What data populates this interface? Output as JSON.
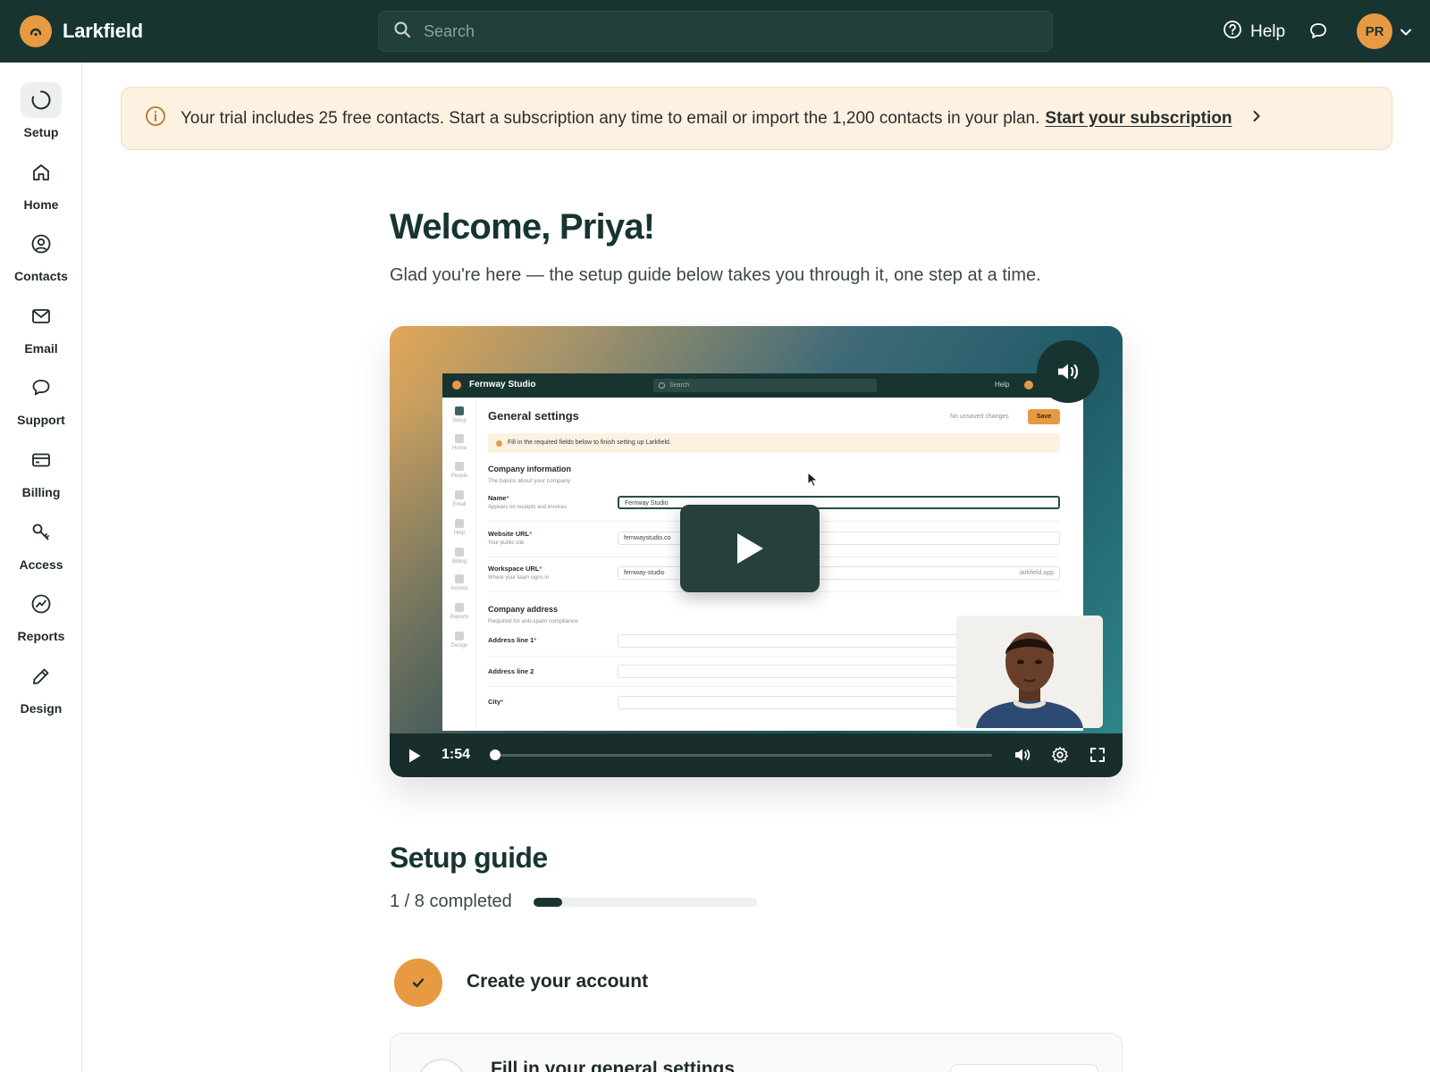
{
  "brand": {
    "name": "Larkfield"
  },
  "search": {
    "placeholder": "Search"
  },
  "header": {
    "help_label": "Help",
    "avatar_initials": "PR"
  },
  "colors": {
    "topbar": "#173431",
    "accent": "#e89a42",
    "banner_bg": "#fdf1e2"
  },
  "sidebar": {
    "items": [
      {
        "label": "Setup",
        "icon": "spinner-icon",
        "active": true
      },
      {
        "label": "Home",
        "icon": "home-icon"
      },
      {
        "label": "Contacts",
        "icon": "user-circle-icon"
      },
      {
        "label": "Email",
        "icon": "mail-icon"
      },
      {
        "label": "Support",
        "icon": "chat-bubble-icon"
      },
      {
        "label": "Billing",
        "icon": "credit-card-icon"
      },
      {
        "label": "Access",
        "icon": "key-icon"
      },
      {
        "label": "Reports",
        "icon": "chart-icon"
      },
      {
        "label": "Design",
        "icon": "pencil-icon"
      }
    ]
  },
  "banner": {
    "text": "Your trial includes 25 free contacts. Start a subscription any time to email or import the 1,200 contacts in your plan.",
    "link": "Start your subscription"
  },
  "main": {
    "title": "Welcome, Priya!",
    "subtitle": "Glad you're here — the setup guide below takes you through it, one step at a time."
  },
  "video": {
    "time": "1:54",
    "progress": 0.01,
    "mock": {
      "brand": "Fernway Studio",
      "search": "Search",
      "help": "Help",
      "nav": [
        "Setup",
        "Home",
        "People",
        "Email",
        "Help",
        "Billing",
        "Access",
        "Reports",
        "Design"
      ],
      "heading": "General settings",
      "unsaved": "No unsaved changes",
      "save": "Save",
      "alert": "Fill in the required fields below to finish setting up Larkfield.",
      "company_info": "Company information",
      "company_info_sub": "The basics about your company",
      "name_label": "Name",
      "name_hint": "Appears on receipts and invoices",
      "name_value": "Fernway Studio",
      "website_label": "Website URL",
      "website_hint": "Your public site",
      "website_value": "fernwaystudio.co",
      "workspace_label": "Workspace URL",
      "workspace_hint": "Where your team signs in",
      "workspace_value": "fernway-studio",
      "workspace_suffix": ".larkfield.app",
      "address_title": "Company address",
      "address_sub": "Required for anti-spam compliance",
      "address1": "Address line 1",
      "address2": "Address line 2",
      "city": "City",
      "required_mark": "*"
    }
  },
  "guide": {
    "title": "Setup guide",
    "progress_text": "1 / 8 completed",
    "completed": 1,
    "total": 8,
    "steps": [
      {
        "label": "Create your account",
        "done": true
      },
      {
        "label": "Fill in your general settings",
        "done": false
      }
    ]
  }
}
